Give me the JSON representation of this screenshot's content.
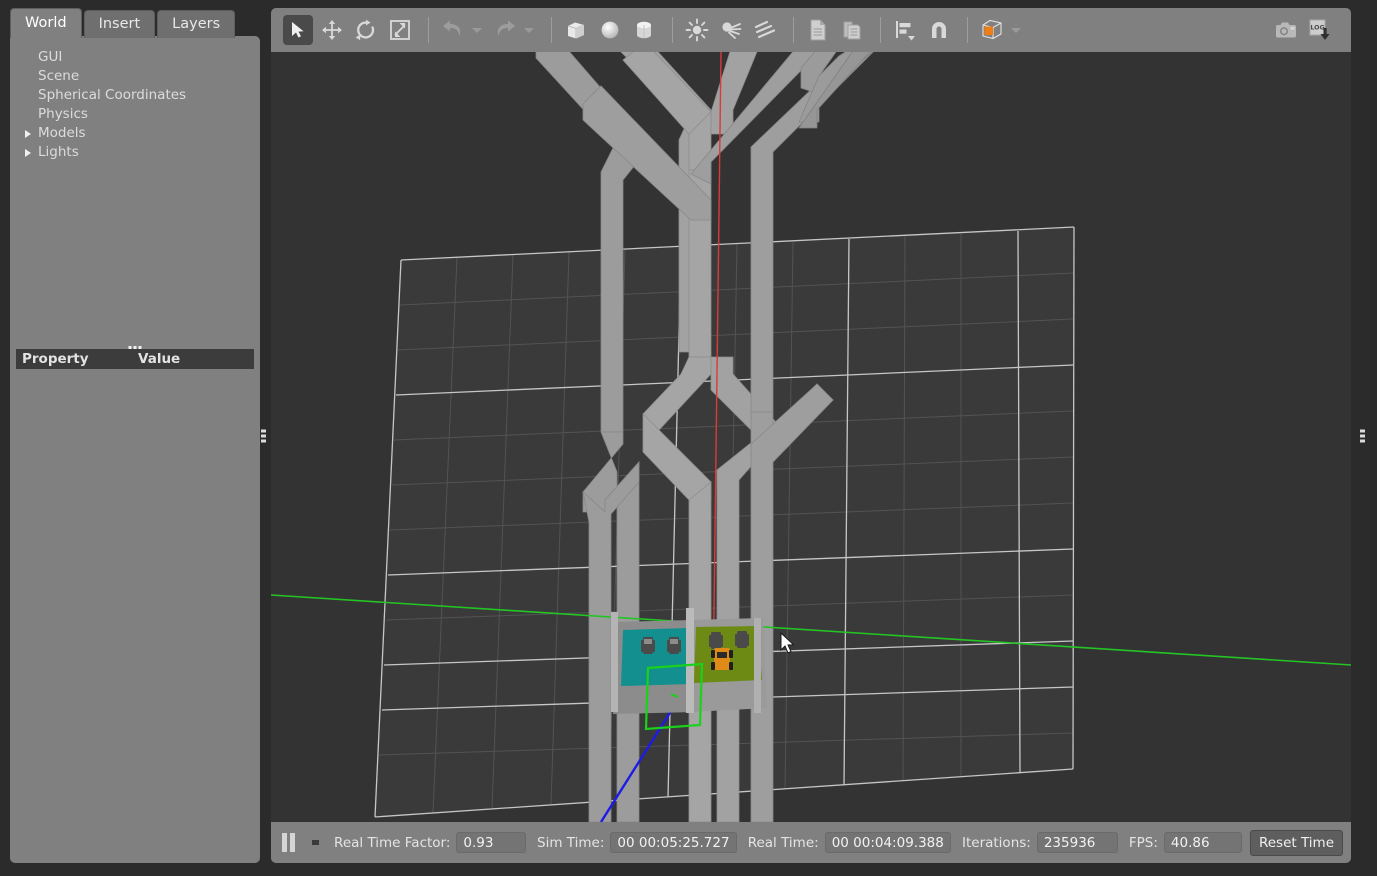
{
  "app": {
    "name": "Gazebo Simulator"
  },
  "left_panel": {
    "tabs": [
      {
        "label": "World",
        "active": true
      },
      {
        "label": "Insert",
        "active": false
      },
      {
        "label": "Layers",
        "active": false
      }
    ],
    "tree_items": [
      {
        "label": "GUI",
        "expandable": false
      },
      {
        "label": "Scene",
        "expandable": false
      },
      {
        "label": "Spherical Coordinates",
        "expandable": false
      },
      {
        "label": "Physics",
        "expandable": false
      },
      {
        "label": "Models",
        "expandable": true
      },
      {
        "label": "Lights",
        "expandable": true
      }
    ],
    "property_table": {
      "col_property": "Property",
      "col_value": "Value",
      "rows": []
    }
  },
  "toolbar": {
    "items": [
      {
        "name": "select-mode",
        "icon": "arrow-cursor-icon",
        "active": true,
        "enabled": true
      },
      {
        "name": "translate-mode",
        "icon": "move-arrows-icon",
        "active": false,
        "enabled": true
      },
      {
        "name": "rotate-mode",
        "icon": "rotate-icon",
        "active": false,
        "enabled": true
      },
      {
        "name": "scale-mode",
        "icon": "scale-icon",
        "active": false,
        "enabled": true
      },
      {
        "name": "undo",
        "icon": "undo-arrow-icon",
        "active": false,
        "enabled": false
      },
      {
        "name": "undo-history",
        "icon": "chevron-down-icon",
        "active": false,
        "enabled": false
      },
      {
        "name": "redo",
        "icon": "redo-arrow-icon",
        "active": false,
        "enabled": false
      },
      {
        "name": "redo-history",
        "icon": "chevron-down-icon",
        "active": false,
        "enabled": false
      },
      {
        "name": "insert-box",
        "icon": "box-icon",
        "active": false,
        "enabled": true
      },
      {
        "name": "insert-sphere",
        "icon": "sphere-icon",
        "active": false,
        "enabled": true
      },
      {
        "name": "insert-cylinder",
        "icon": "cylinder-icon",
        "active": false,
        "enabled": true
      },
      {
        "name": "insert-point-light",
        "icon": "point-light-icon",
        "active": false,
        "enabled": true
      },
      {
        "name": "insert-spot-light",
        "icon": "spot-light-icon",
        "active": false,
        "enabled": true
      },
      {
        "name": "insert-directional-light",
        "icon": "directional-light-icon",
        "active": false,
        "enabled": true
      },
      {
        "name": "copy",
        "icon": "copy-icon",
        "active": false,
        "enabled": true
      },
      {
        "name": "paste",
        "icon": "paste-icon",
        "active": false,
        "enabled": true
      },
      {
        "name": "align",
        "icon": "align-icon",
        "active": false,
        "enabled": true
      },
      {
        "name": "snap",
        "icon": "magnet-snap-icon",
        "active": false,
        "enabled": true
      },
      {
        "name": "view-angle",
        "icon": "view-cube-icon",
        "active": false,
        "enabled": true
      },
      {
        "name": "screenshot",
        "icon": "camera-icon",
        "active": false,
        "enabled": true
      },
      {
        "name": "log-record",
        "icon": "log-download-icon",
        "active": false,
        "enabled": true
      }
    ],
    "log_badge": "LOG"
  },
  "status_bar": {
    "pause_icon": "pause-icon",
    "step_icon": "step-icon",
    "real_time_factor_label": "Real Time Factor:",
    "real_time_factor_value": "0.93",
    "sim_time_label": "Sim Time:",
    "sim_time_value": "00 00:05:25.727",
    "real_time_label": "Real Time:",
    "real_time_value": "00 00:04:09.388",
    "iterations_label": "Iterations:",
    "iterations_value": "235936",
    "fps_label": "FPS:",
    "fps_value": "40.86",
    "reset_time_label": "Reset Time"
  },
  "scene": {
    "description": "3D simulation viewport with gray maze walls, ground grid plane, teal and olive platforms with small robot models, an orange mobile robot, and a green wireframe selection box",
    "colors": {
      "background": "#333333",
      "ground": "#3a3a3a",
      "grid_minor": "#585858",
      "grid_major": "#c8c8c8",
      "wall": "#9e9e9e",
      "wall_shade": "#7e7e7e",
      "axis_x_red": "#e02020",
      "axis_y_green": "#22cc22",
      "axis_z_blue": "#1a1aee",
      "selection_green": "#16d816",
      "platform_teal": "#169a9a",
      "platform_olive": "#6e8a16",
      "robot_orange": "#e08a18"
    }
  }
}
